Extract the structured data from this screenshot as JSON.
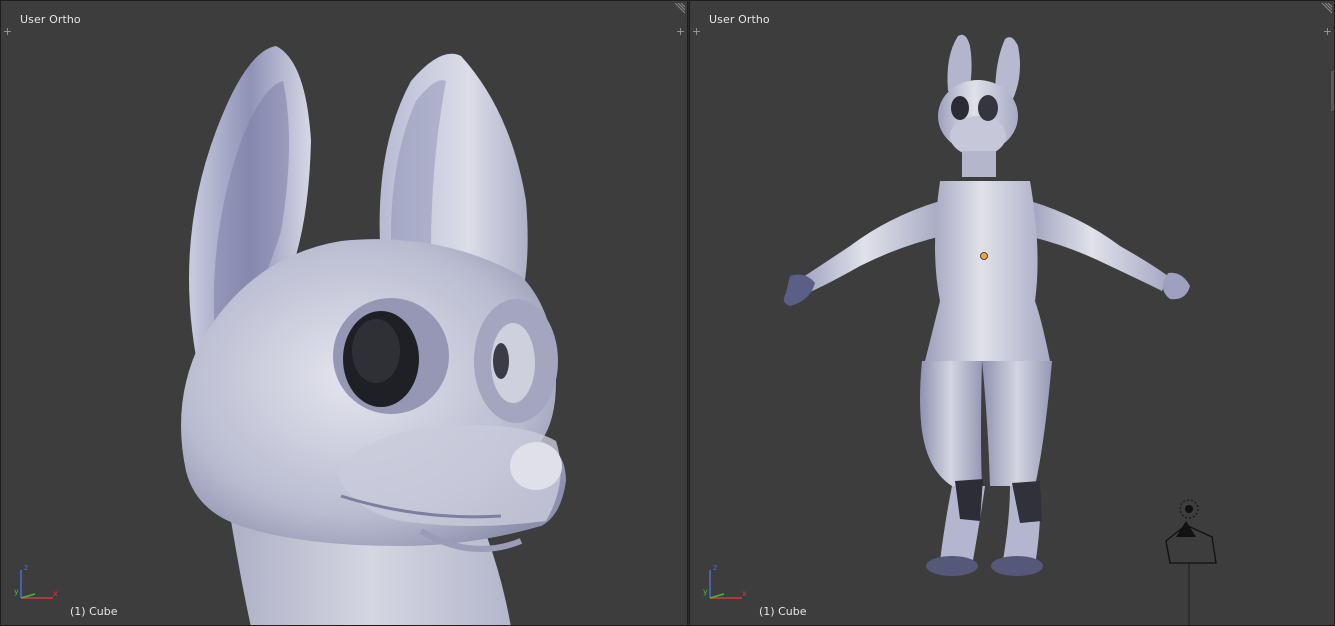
{
  "viewports": {
    "left": {
      "title": "User Ortho",
      "object_label": "(1) Cube"
    },
    "right": {
      "title": "User Ortho",
      "object_label": "(1) Cube"
    }
  },
  "axis_labels": {
    "x": "x",
    "y": "y",
    "z": "z"
  },
  "colors": {
    "viewport_bg": "#3d3d3d",
    "mesh_light": "#dcdde6",
    "mesh_mid": "#aeb0c8",
    "mesh_dark": "#6f7196",
    "text": "#e6e6e6",
    "axis_x": "#d9363c",
    "axis_y": "#3bbf3b",
    "axis_z": "#4b6bd6",
    "origin_dot": "#f0a33b"
  },
  "icons": {
    "add": "plus-icon",
    "split": "corner-grip-icon",
    "gizmo": "axis-gizmo-icon",
    "camera": "camera-icon",
    "lamp": "lamp-icon"
  }
}
